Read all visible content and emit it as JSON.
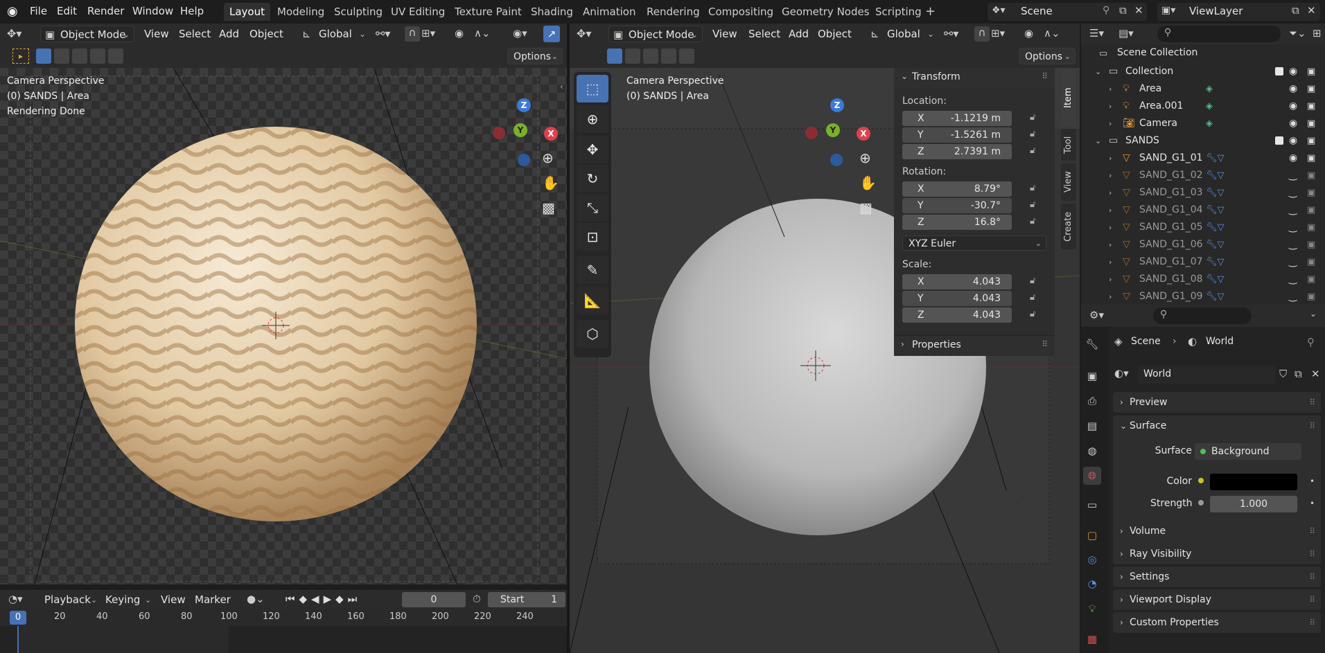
{
  "topbar": {
    "menus": [
      "File",
      "Edit",
      "Render",
      "Window",
      "Help"
    ],
    "workspaces": [
      "Layout",
      "Modeling",
      "Sculpting",
      "UV Editing",
      "Texture Paint",
      "Shading",
      "Animation",
      "Rendering",
      "Compositing",
      "Geometry Nodes",
      "Scripting"
    ],
    "active_workspace": "Layout",
    "scene": "Scene",
    "view_layer": "ViewLayer"
  },
  "left_viewport": {
    "mode": "Object Mode",
    "menus": [
      "View",
      "Select",
      "Add",
      "Object"
    ],
    "orientation": "Global",
    "options": "Options",
    "overlay_line1": "Camera Perspective",
    "overlay_line2": "(0) SANDS | Area",
    "overlay_line3": "Rendering Done"
  },
  "right_viewport": {
    "mode": "Object Mode",
    "menus": [
      "View",
      "Select",
      "Add",
      "Object"
    ],
    "orientation": "Global",
    "options": "Options",
    "overlay_line1": "Camera Perspective",
    "overlay_line2": "(0) SANDS | Area"
  },
  "nav_gizmo": {
    "x": "X",
    "y": "Y",
    "z": "Z"
  },
  "transform": {
    "title": "Transform",
    "location_label": "Location:",
    "location": [
      {
        "axis": "X",
        "value": "-1.1219 m"
      },
      {
        "axis": "Y",
        "value": "-1.5261 m"
      },
      {
        "axis": "Z",
        "value": "2.7391 m"
      }
    ],
    "rotation_label": "Rotation:",
    "rotation": [
      {
        "axis": "X",
        "value": "8.79°"
      },
      {
        "axis": "Y",
        "value": "-30.7°"
      },
      {
        "axis": "Z",
        "value": "16.8°"
      }
    ],
    "rotation_mode": "XYZ Euler",
    "scale_label": "Scale:",
    "scale": [
      {
        "axis": "X",
        "value": "4.043"
      },
      {
        "axis": "Y",
        "value": "4.043"
      },
      {
        "axis": "Z",
        "value": "4.043"
      }
    ],
    "properties": "Properties"
  },
  "sidebar_tabs": [
    "Item",
    "Tool",
    "View",
    "Create"
  ],
  "timeline": {
    "menus": [
      "Playback",
      "Keying",
      "View",
      "Marker"
    ],
    "current_frame": "0",
    "start_label": "Start",
    "start_value": "1",
    "ticks": [
      "0",
      "20",
      "40",
      "60",
      "80",
      "100",
      "120",
      "140",
      "160",
      "180",
      "200",
      "220",
      "240"
    ]
  },
  "outliner": {
    "root": "Scene Collection",
    "rows": [
      {
        "name": "Collection",
        "dim": false
      },
      {
        "name": "Area",
        "dim": false
      },
      {
        "name": "Area.001",
        "dim": false
      },
      {
        "name": "Camera",
        "dim": false
      },
      {
        "name": "SANDS",
        "dim": false
      },
      {
        "name": "SAND_G1_01",
        "dim": false
      },
      {
        "name": "SAND_G1_02",
        "dim": true
      },
      {
        "name": "SAND_G1_03",
        "dim": true
      },
      {
        "name": "SAND_G1_04",
        "dim": true
      },
      {
        "name": "SAND_G1_05",
        "dim": true
      },
      {
        "name": "SAND_G1_06",
        "dim": true
      },
      {
        "name": "SAND_G1_07",
        "dim": true
      },
      {
        "name": "SAND_G1_08",
        "dim": true
      },
      {
        "name": "SAND_G1_09",
        "dim": true
      }
    ]
  },
  "properties": {
    "breadcrumb_scene": "Scene",
    "breadcrumb_world": "World",
    "world_name": "World",
    "sections": {
      "preview": "Preview",
      "surface": "Surface",
      "volume": "Volume",
      "ray_visibility": "Ray Visibility",
      "settings": "Settings",
      "viewport_display": "Viewport Display",
      "custom_properties": "Custom Properties"
    },
    "surface_label": "Surface",
    "surface_value": "Background",
    "color_label": "Color",
    "color_value": "#000000",
    "strength_label": "Strength",
    "strength_value": "1.000"
  },
  "colors": {
    "accent": "#4772b3",
    "x_axis": "#e0404a",
    "y_axis": "#7bb02a",
    "z_axis": "#3b7ad9"
  }
}
